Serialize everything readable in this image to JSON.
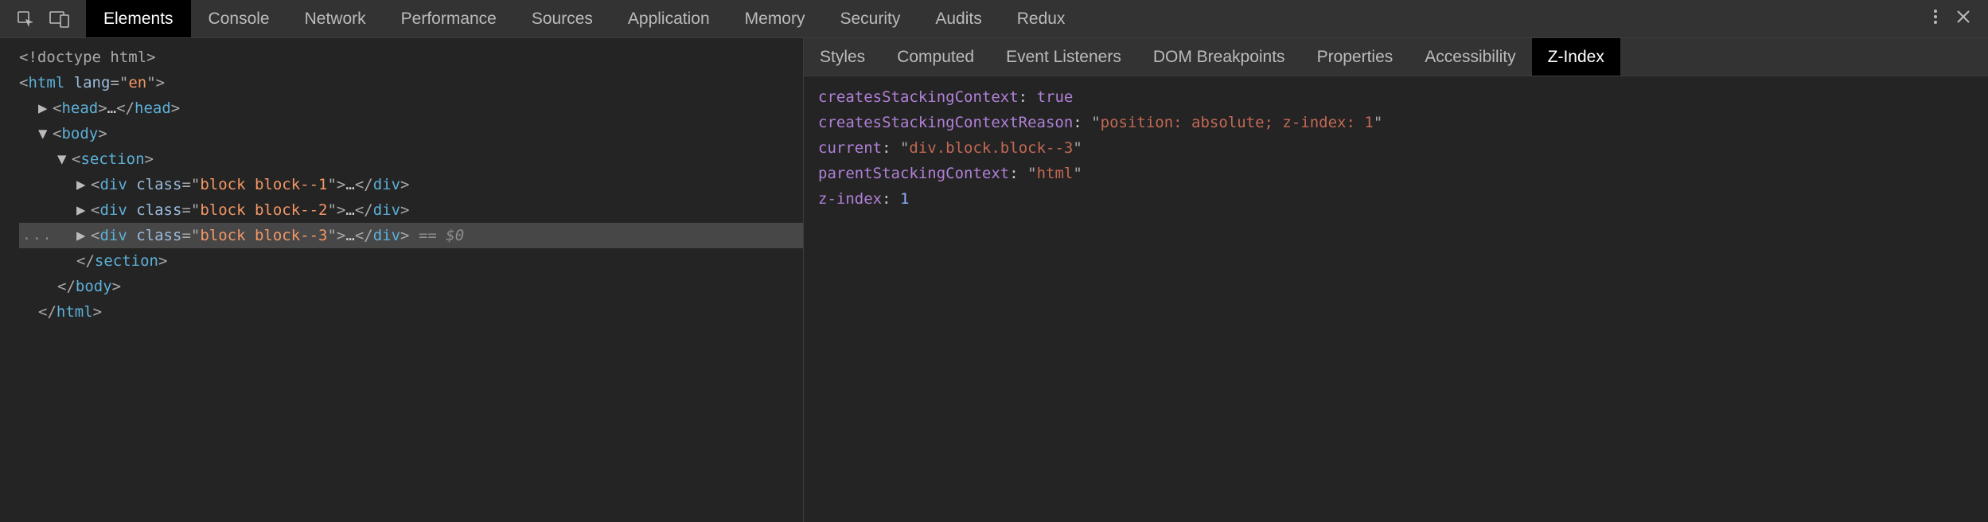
{
  "topTabs": {
    "items": [
      "Elements",
      "Console",
      "Network",
      "Performance",
      "Sources",
      "Application",
      "Memory",
      "Security",
      "Audits",
      "Redux"
    ],
    "activeIndex": 0
  },
  "tree": {
    "doctype": "<!doctype html>",
    "html_open_tag": "html",
    "html_open_attr": "lang",
    "html_open_val": "en",
    "head": {
      "tag": "head",
      "ellipsis": "…"
    },
    "body_tag": "body",
    "section_tag": "section",
    "rows": [
      {
        "tag": "div",
        "attr": "class",
        "val": "block block--1",
        "ellipsis": "…"
      },
      {
        "tag": "div",
        "attr": "class",
        "val": "block block--2",
        "ellipsis": "…"
      },
      {
        "tag": "div",
        "attr": "class",
        "val": "block block--3",
        "ellipsis": "…",
        "ref": "== $0",
        "selected": true
      }
    ],
    "section_close": "section",
    "body_close": "body",
    "html_close": "html"
  },
  "sideTabs": {
    "items": [
      "Styles",
      "Computed",
      "Event Listeners",
      "DOM Breakpoints",
      "Properties",
      "Accessibility",
      "Z-Index"
    ],
    "activeIndex": 6
  },
  "zindex": {
    "p1_key": "createsStackingContext",
    "p1_val": "true",
    "p2_key": "createsStackingContextReason",
    "p2_val": "position: absolute; z-index: 1",
    "p3_key": "current",
    "p3_val": "div.block.block--3",
    "p4_key": "parentStackingContext",
    "p4_val": "html",
    "p5_key": "z-index",
    "p5_val": "1"
  },
  "glyphs": {
    "ellipsis_marker": "..."
  }
}
